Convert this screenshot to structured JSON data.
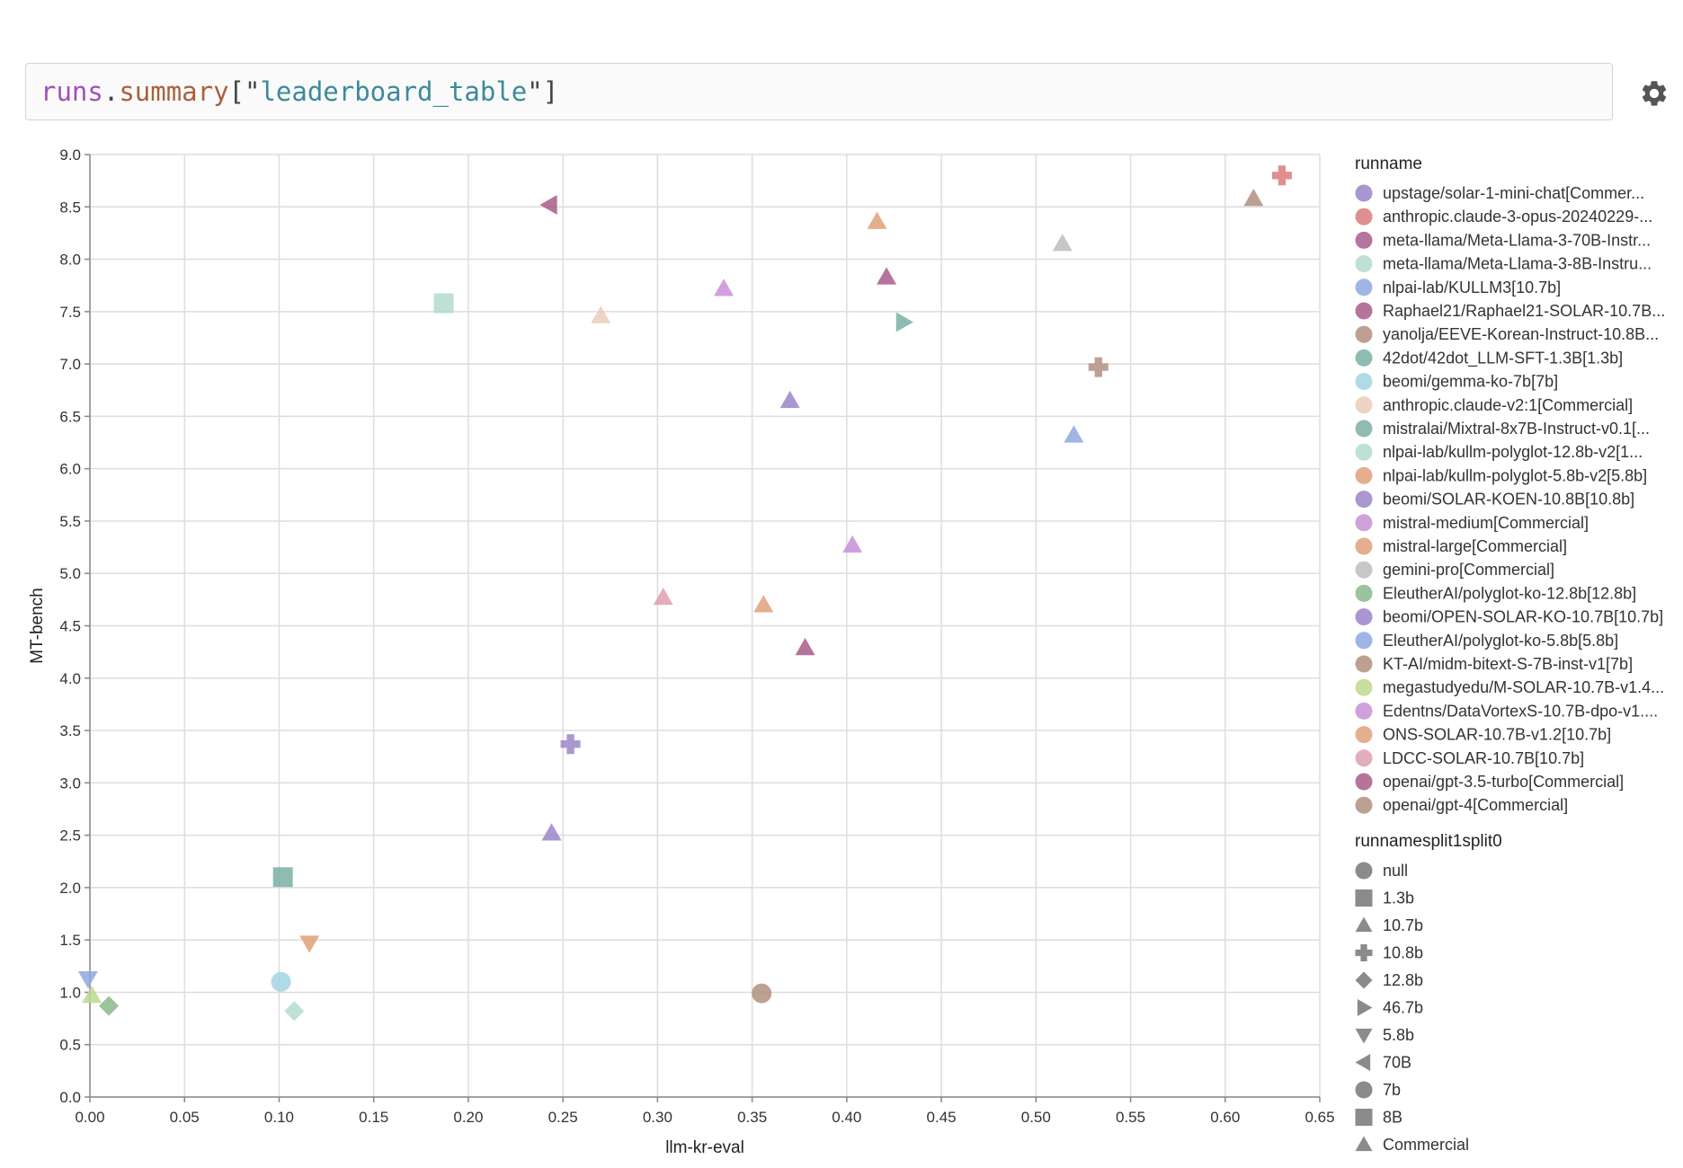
{
  "query": {
    "obj": "runs",
    "dot": ".",
    "attr": "summary",
    "open": "[\"",
    "key": "leaderboard_table",
    "close": "\"]"
  },
  "settings_icon": "gear-icon",
  "chart_data": {
    "type": "scatter",
    "xlabel": "llm-kr-eval",
    "ylabel": "MT-bench",
    "xlim": [
      0,
      0.65
    ],
    "ylim": [
      0,
      9
    ],
    "x_ticks": [
      "0.00",
      "0.05",
      "0.10",
      "0.15",
      "0.20",
      "0.25",
      "0.30",
      "0.35",
      "0.40",
      "0.45",
      "0.50",
      "0.55",
      "0.60",
      "0.65"
    ],
    "y_ticks": [
      "0.0",
      "0.5",
      "1.0",
      "1.5",
      "2.0",
      "2.5",
      "3.0",
      "3.5",
      "4.0",
      "4.5",
      "5.0",
      "5.5",
      "6.0",
      "6.5",
      "7.0",
      "7.5",
      "8.0",
      "8.5",
      "9.0"
    ],
    "grid": true,
    "legend_placement": "right",
    "color_legend_title": "runname",
    "shape_legend_title": "runnamesplit1split0",
    "series": [
      {
        "name": "upstage/solar-1-mini-chat[Commer...",
        "color": "#9b84c9",
        "shape": "triangle-up",
        "x": 0.37,
        "y": 6.65
      },
      {
        "name": "anthropic.claude-3-opus-20240229-...",
        "color": "#d97b7b",
        "shape": "cross",
        "x": 0.63,
        "y": 8.8
      },
      {
        "name": "meta-llama/Meta-Llama-3-70B-Instr...",
        "color": "#a85c8a",
        "shape": "triangle-left",
        "x": 0.243,
        "y": 8.52
      },
      {
        "name": "meta-llama/Meta-Llama-3-8B-Instru...",
        "color": "#b3dbd0",
        "shape": "square",
        "x": 0.187,
        "y": 7.58
      },
      {
        "name": "nlpai-lab/KULLM3[10.7b]",
        "color": "#8fa8e0",
        "shape": "triangle-up",
        "x": 0.52,
        "y": 6.32
      },
      {
        "name": "Raphael21/Raphael21-SOLAR-10.7B...",
        "color": "#a85c8a",
        "shape": "triangle-up",
        "x": 0.378,
        "y": 4.29
      },
      {
        "name": "yanolja/EEVE-Korean-Instruct-10.8B...",
        "color": "#b09080",
        "shape": "cross",
        "x": 0.533,
        "y": 6.97
      },
      {
        "name": "42dot/42dot_LLM-SFT-1.3B[1.3b]",
        "color": "#7ab0a6",
        "shape": "square",
        "x": 0.102,
        "y": 2.1
      },
      {
        "name": "beomi/gemma-ko-7b[7b]",
        "color": "#a3d4e3",
        "shape": "circle",
        "x": 0.101,
        "y": 1.1
      },
      {
        "name": "anthropic.claude-v2:1[Commercial]",
        "color": "#ebcdb7",
        "shape": "triangle-up",
        "x": 0.27,
        "y": 7.46
      },
      {
        "name": "mistralai/Mixtral-8x7B-Instruct-v0.1[...",
        "color": "#7ab0a6",
        "shape": "triangle-right",
        "x": 0.43,
        "y": 7.4
      },
      {
        "name": "nlpai-lab/kullm-polyglot-12.8b-v2[1...",
        "color": "#b3dbd0",
        "shape": "diamond",
        "x": 0.108,
        "y": 0.82
      },
      {
        "name": "nlpai-lab/kullm-polyglot-5.8b-v2[5.8b]",
        "color": "#e0a07a",
        "shape": "triangle-down",
        "x": 0.116,
        "y": 1.47
      },
      {
        "name": "beomi/SOLAR-KOEN-10.8B[10.8b]",
        "color": "#9b84c9",
        "shape": "cross",
        "x": 0.254,
        "y": 3.37
      },
      {
        "name": "mistral-medium[Commercial]",
        "color": "#c88fd6",
        "shape": "triangle-up",
        "x": 0.335,
        "y": 7.72
      },
      {
        "name": "mistral-large[Commercial]",
        "color": "#e0a07a",
        "shape": "triangle-up",
        "x": 0.416,
        "y": 8.36
      },
      {
        "name": "gemini-pro[Commercial]",
        "color": "#bdbdbd",
        "shape": "triangle-up",
        "x": 0.514,
        "y": 8.15
      },
      {
        "name": "EleutherAI/polyglot-ko-12.8b[12.8b]",
        "color": "#8bb88b",
        "shape": "diamond",
        "x": 0.01,
        "y": 0.87
      },
      {
        "name": "beomi/OPEN-SOLAR-KO-10.7B[10.7b]",
        "color": "#9b84c9",
        "shape": "triangle-up",
        "x": 0.244,
        "y": 2.52
      },
      {
        "name": "EleutherAI/polyglot-ko-5.8b[5.8b]",
        "color": "#8fa8e0",
        "shape": "triangle-down",
        "x": -0.001,
        "y": 1.13
      },
      {
        "name": "KT-AI/midm-bitext-S-7B-inst-v1[7b]",
        "color": "#b09080",
        "shape": "circle",
        "x": 0.355,
        "y": 0.99
      },
      {
        "name": "megastudyedu/M-SOLAR-10.7B-v1.4...",
        "color": "#bcd98e",
        "shape": "triangle-up",
        "x": 0.001,
        "y": 0.97
      },
      {
        "name": "Edentns/DataVortexS-10.7B-dpo-v1....",
        "color": "#c88fd6",
        "shape": "triangle-up",
        "x": 0.403,
        "y": 5.27
      },
      {
        "name": "ONS-SOLAR-10.7B-v1.2[10.7b]",
        "color": "#e0a07a",
        "shape": "triangle-up",
        "x": 0.356,
        "y": 4.7
      },
      {
        "name": "LDCC-SOLAR-10.7B[10.7b]",
        "color": "#dea0b0",
        "shape": "triangle-up",
        "x": 0.303,
        "y": 4.77
      },
      {
        "name": "openai/gpt-3.5-turbo[Commercial]",
        "color": "#a85c8a",
        "shape": "triangle-up",
        "x": 0.421,
        "y": 7.83
      },
      {
        "name": "openai/gpt-4[Commercial]",
        "color": "#b09080",
        "shape": "triangle-up",
        "x": 0.615,
        "y": 8.58
      }
    ],
    "shape_legend": [
      {
        "label": "null",
        "shape": "circle"
      },
      {
        "label": "1.3b",
        "shape": "square"
      },
      {
        "label": "10.7b",
        "shape": "triangle-up"
      },
      {
        "label": "10.8b",
        "shape": "cross"
      },
      {
        "label": "12.8b",
        "shape": "diamond"
      },
      {
        "label": "46.7b",
        "shape": "triangle-right"
      },
      {
        "label": "5.8b",
        "shape": "triangle-down"
      },
      {
        "label": "70B",
        "shape": "triangle-left"
      },
      {
        "label": "7b",
        "shape": "circle"
      },
      {
        "label": "8B",
        "shape": "square"
      },
      {
        "label": "Commercial",
        "shape": "triangle-up"
      }
    ]
  }
}
